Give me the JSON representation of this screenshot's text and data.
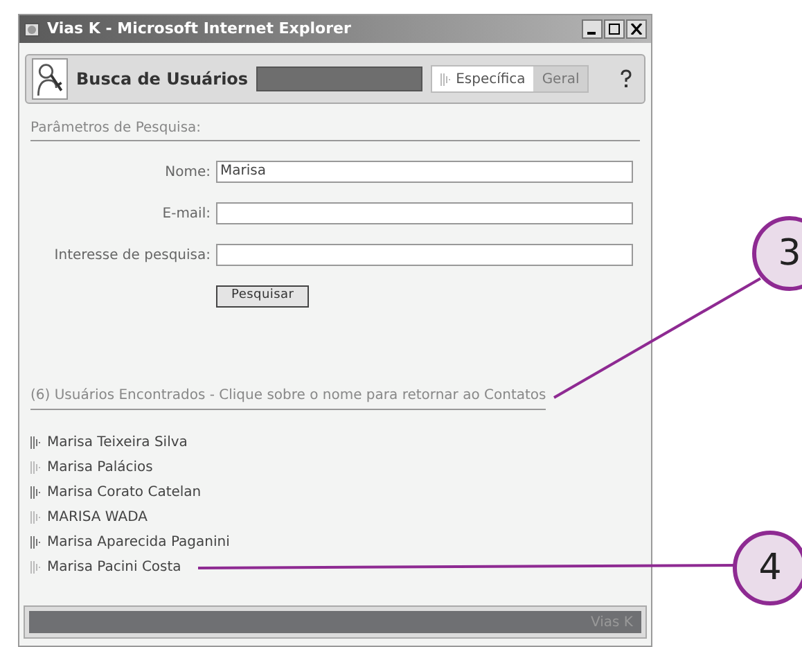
{
  "window": {
    "title": "Vias K - Microsoft Internet Explorer"
  },
  "header": {
    "title": "Busca de Usuários",
    "tabs": [
      {
        "label": "Específica",
        "selected": true
      },
      {
        "label": "Geral",
        "selected": false
      }
    ]
  },
  "search_section": {
    "heading": "Parâmetros de Pesquisa:",
    "fields": [
      {
        "label": "Nome:",
        "value": "Marisa"
      },
      {
        "label": "E-mail:"
      },
      {
        "label": "Interesse de pesquisa:"
      }
    ],
    "button": "Pesquisar"
  },
  "results": {
    "heading": "(6) Usuários Encontrados - Clique sobre o nome para retornar ao Contatos",
    "items": [
      "Marisa Teixeira Silva",
      "Marisa Palácios",
      "Marisa Corato Catelan",
      "MARISA WADA",
      "Marisa Aparecida Paganini",
      "Marisa Pacini Costa"
    ]
  },
  "footer": {
    "text": "Vias K"
  },
  "callouts": [
    {
      "number": "3"
    },
    {
      "number": "4"
    }
  ]
}
